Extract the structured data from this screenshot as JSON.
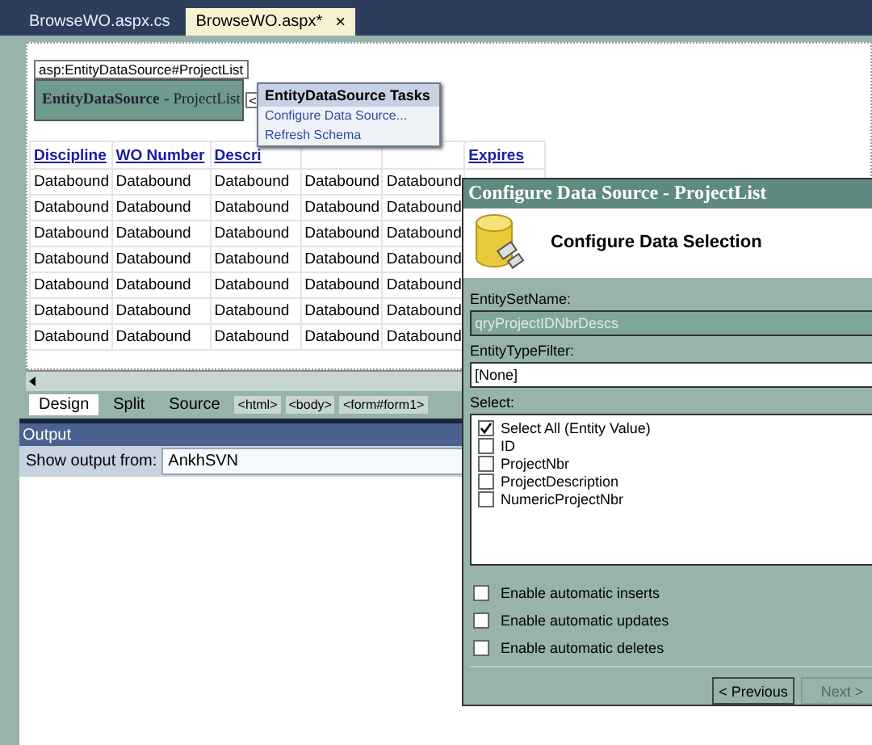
{
  "document_tabs": [
    {
      "label": "BrowseWO.aspx.cs",
      "selected": false
    },
    {
      "label": "BrowseWO.aspx*",
      "selected": true,
      "close": "×"
    }
  ],
  "designer": {
    "datasource": {
      "tag": "asp:EntityDataSource#ProjectList",
      "type": "EntityDataSource",
      "id": "- ProjectList",
      "smart_tag": "<"
    },
    "tasks_popup": {
      "title": "EntityDataSource Tasks",
      "items": [
        "Configure Data Source...",
        "Refresh Schema"
      ]
    },
    "grid": {
      "columns": [
        {
          "heading": "Discipline"
        },
        {
          "heading": "WO Number"
        },
        {
          "heading": "Descri"
        },
        {},
        {},
        {
          "heading": "Expires"
        }
      ],
      "rows": [
        [
          "Databound",
          "Databound",
          "Databound",
          "Databound",
          "Databound"
        ],
        [
          "Databound",
          "Databound",
          "Databound",
          "Databound",
          "Databound"
        ],
        [
          "Databound",
          "Databound",
          "Databound",
          "Databound",
          "Databound"
        ],
        [
          "Databound",
          "Databound",
          "Databound",
          "Databound",
          "Databound"
        ],
        [
          "Databound",
          "Databound",
          "Databound",
          "Databound",
          "Databound"
        ],
        [
          "Databound",
          "Databound",
          "Databound",
          "Databound",
          "Databound"
        ],
        [
          "Databound",
          "Databound",
          "Databound",
          "Databound",
          "Databound"
        ]
      ]
    },
    "view_tabs": [
      {
        "label": "Design",
        "selected": true
      },
      {
        "label": "Split",
        "selected": false
      },
      {
        "label": "Source",
        "selected": false
      }
    ],
    "breadcrumbs": [
      "<html>",
      "<body>",
      "<form#form1>"
    ]
  },
  "output": {
    "title": "Output",
    "show_from_label": "Show output from:",
    "show_from_value": "AnkhSVN"
  },
  "dialog": {
    "title": "Configure Data Source - ProjectList",
    "heading": "Configure Data Selection",
    "entity_set_label": "EntitySetName:",
    "entity_set_value": "qryProjectIDNbrDescs",
    "entity_set_disabled": true,
    "type_filter_label": "EntityTypeFilter:",
    "type_filter_value": "[None]",
    "select_label": "Select:",
    "select_items": [
      {
        "label": "Select All (Entity Value)",
        "checked": true
      },
      {
        "label": "ID",
        "checked": false
      },
      {
        "label": "ProjectNbr",
        "checked": false
      },
      {
        "label": "ProjectDescription",
        "checked": false
      },
      {
        "label": "NumericProjectNbr",
        "checked": false
      }
    ],
    "options": [
      {
        "label": "Enable automatic inserts",
        "checked": false
      },
      {
        "label": "Enable automatic updates",
        "checked": false
      },
      {
        "label": "Enable automatic deletes",
        "checked": false
      }
    ],
    "buttons": [
      {
        "label": "< Previous",
        "disabled": false
      },
      {
        "label": "Next >",
        "disabled": true
      }
    ]
  }
}
